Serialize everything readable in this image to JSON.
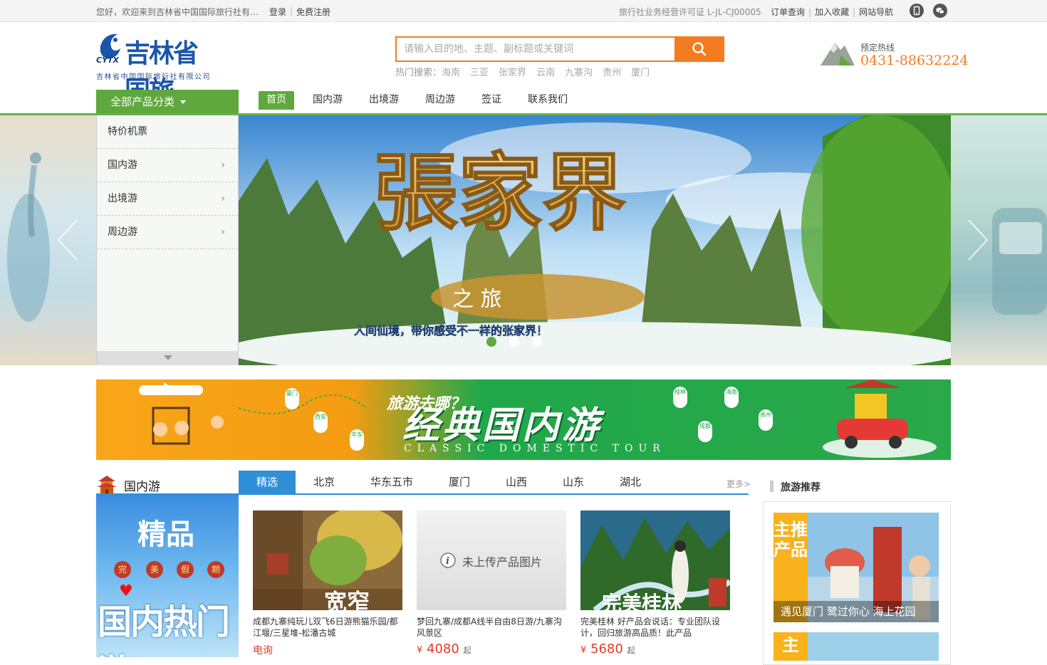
{
  "topbar": {
    "welcome": "您好，欢迎来到吉林省中国国际旅行社有…",
    "login": "登录",
    "register": "免费注册",
    "license": "旅行社业务经营许可证  L-JL-CJ00005",
    "links": [
      "订单查询",
      "加入收藏",
      "网站导航"
    ]
  },
  "logo": {
    "name": "吉林省国旅",
    "abbr": "CYTX",
    "subtitle": "吉林省中国国际旅行社有限公司"
  },
  "search": {
    "placeholder": "请输入目的地、主题、副标题或关键词",
    "hot_label": "热门搜索：",
    "hot_keywords": [
      "海南",
      "三亚",
      "张家界",
      "云南",
      "九寨沟",
      "贵州",
      "厦门"
    ]
  },
  "hotline": {
    "label": "预定热线",
    "number": "0431-88632224"
  },
  "nav": {
    "all_categories": "全部产品分类",
    "items": [
      "首页",
      "国内游",
      "出境游",
      "周边游",
      "签证",
      "联系我们"
    ]
  },
  "category_menu": [
    "特价机票",
    "国内游",
    "出境游",
    "周边游"
  ],
  "banner": {
    "slide_count": 3,
    "active_slide": 1
  },
  "ad_strip": {
    "tagline": "旅游去哪？",
    "headline": "经典国内游",
    "english": "CLASSIC  DOMESTIC  TOUR",
    "pins": [
      "厦门",
      "西安",
      "华东",
      "桂林",
      "海南",
      "成都",
      "贵州"
    ]
  },
  "domestic": {
    "title": "国内游",
    "promo": {
      "line1": "精品",
      "circles": [
        "完",
        "美",
        "假",
        "期"
      ],
      "line2": "国内热门游"
    },
    "tabs": [
      "精选",
      "北京",
      "华东五市",
      "厦门",
      "山西",
      "山东",
      "湖北"
    ],
    "more": "更多>",
    "no_image_text": "未上传产品图片",
    "products": [
      {
        "title": "成都九寨纯玩儿双飞6日游熊猫乐园/都江堰/三星堆-松潘古城",
        "price_text": "电询",
        "overlay": "宽窄"
      },
      {
        "title": "梦回九寨/成都A线半自由8日游/九寨沟风景区",
        "currency": "¥",
        "price": "4080",
        "suffix": "起"
      },
      {
        "title": "完美桂林 好产品会说话：专业团队设计，回归旅游高品质！此产品",
        "currency": "¥",
        "price": "5680",
        "suffix": "起",
        "overlay": "完美桂林"
      }
    ]
  },
  "recommend": {
    "title": "旅游推荐",
    "items": [
      {
        "label": "主推产品",
        "caption": "遇见厦门 鹭过你心 海上花园"
      },
      {
        "label": "主",
        "caption": ""
      }
    ]
  },
  "colors": {
    "green": "#5fa83e",
    "orange": "#f47b20",
    "blue": "#2f8fd8",
    "price_red": "#e23b26"
  }
}
